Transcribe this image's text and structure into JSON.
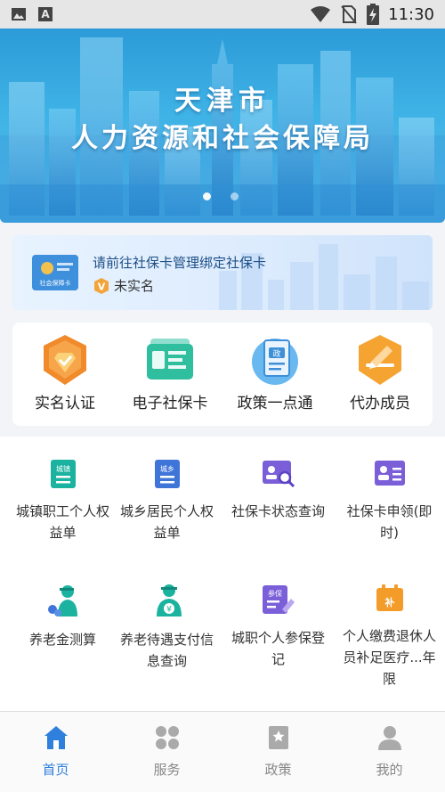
{
  "status_bar": {
    "time": "11:30",
    "icons": [
      "image-icon",
      "a-letter-icon",
      "wifi-icon",
      "no-sim-icon",
      "battery-charging-icon"
    ]
  },
  "banner": {
    "title_line1": "天津市",
    "title_line2": "人力资源和社会保障局",
    "page_count": 2,
    "active_page": 1
  },
  "card_notice": {
    "card_label": "社会保障卡",
    "message": "请前往社保卡管理绑定社保卡",
    "status": "未实名",
    "badge_icon": "v-badge-icon"
  },
  "quick_actions": [
    {
      "label": "实名认证",
      "icon": "verified-shield-icon"
    },
    {
      "label": "电子社保卡",
      "icon": "e-card-icon"
    },
    {
      "label": "政策一点通",
      "icon": "policy-document-icon"
    },
    {
      "label": "代办成员",
      "icon": "proxy-edit-icon"
    }
  ],
  "services": [
    {
      "label": "城镇职工个人权益单",
      "icon": "urban-statement-icon",
      "icon_text": "城镇"
    },
    {
      "label": "城乡居民个人权益单",
      "icon": "rural-statement-icon",
      "icon_text": "城乡"
    },
    {
      "label": "社保卡状态查询",
      "icon": "card-status-search-icon"
    },
    {
      "label": "社保卡申领(即时)",
      "icon": "card-apply-icon"
    },
    {
      "label": "养老金测算",
      "icon": "pension-calc-icon"
    },
    {
      "label": "养老待遇支付信息查询",
      "icon": "pension-payment-icon"
    },
    {
      "label": "城职个人参保登记",
      "icon": "insurance-register-icon",
      "icon_text": "参保"
    },
    {
      "label": "个人缴费退休人员补足医疗...年限",
      "icon": "medical-supplement-icon",
      "icon_text": "补"
    }
  ],
  "tabs": [
    {
      "label": "首页",
      "icon": "home-icon",
      "active": true
    },
    {
      "label": "服务",
      "icon": "services-icon",
      "active": false
    },
    {
      "label": "政策",
      "icon": "policy-icon",
      "active": false
    },
    {
      "label": "我的",
      "icon": "profile-icon",
      "active": false
    }
  ],
  "colors": {
    "accent": "#2f7fdc",
    "teal": "#1bb3a0",
    "purple": "#6f5ad6",
    "orange": "#f39c2a"
  }
}
